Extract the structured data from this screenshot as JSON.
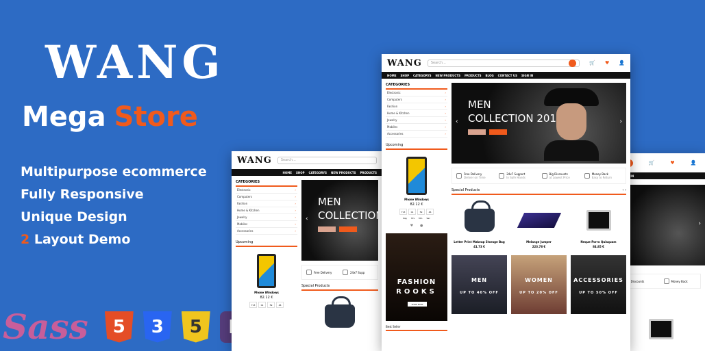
{
  "promo": {
    "logo": "WANG",
    "title_white": "Mega",
    "title_orange": "Store",
    "features": [
      "Multipurpose ecommerce",
      "Fully Responsive",
      "Unique Design"
    ],
    "layout_num": "2",
    "layout_text": "Layout Demo",
    "tech": {
      "sass": "Sass",
      "html5": "5",
      "css3": "3",
      "js": "5",
      "bootstrap": "B"
    }
  },
  "store": {
    "logo": "WANG",
    "search_placeholder": "Search...",
    "nav": [
      "HOME",
      "SHOP",
      "CATEGORYS",
      "NEW PRODUCTS",
      "PRODUCTS",
      "BLOG",
      "CONTACT US",
      "SIGN IN"
    ],
    "categories_title": "CATEGORIES",
    "categories": [
      "Electronic",
      "Computers",
      "Fashion",
      "Home &amp; Kitchen",
      "Jewelry",
      "Mobiles",
      "Accessories"
    ],
    "upcoming_title": "Upcoming",
    "upcoming_product": {
      "name": "Phone Windows",
      "price": "82.12 €",
      "countdown": [
        "713",
        "01",
        "59",
        "46"
      ],
      "countdown_labels": [
        "Day",
        "Hrs",
        "Min",
        "Sec"
      ]
    },
    "hero": {
      "line1": "MEN",
      "line2": "COLLECTION 2019",
      "line2_short": "COLLECTION"
    },
    "services": [
      {
        "title": "Free Delivery",
        "sub": "Deliver on Time"
      },
      {
        "title": "24x7 Support",
        "sub": "In Safe Hands"
      },
      {
        "title": "Big Discounts",
        "sub": "at Lowest Price"
      },
      {
        "title": "Money Back",
        "sub": "Easy to Return"
      }
    ],
    "services_short": [
      "Free Delivery",
      "24x7 Supp"
    ],
    "special_title": "Special Products",
    "products": [
      {
        "name": "Letter Print Makeup Storage Bag",
        "price": "41.73 €"
      },
      {
        "name": "Melange Jumper",
        "price": "223.78 €"
      },
      {
        "name": "Neque Porro Quisquam",
        "price": "84.85 €"
      }
    ],
    "banners": [
      {
        "label": "MEN",
        "sub": "UP TO 40% OFF"
      },
      {
        "label": "WOMEN",
        "sub": "UP TO 20% OFF"
      },
      {
        "label": "ACCESSORIES",
        "sub": "UP TO 50% OFF"
      }
    ],
    "fashion": {
      "l1": "FASHION",
      "l2": "ROOKS",
      "shop": "SHOP NOW"
    },
    "best_seller": "Best Seller",
    "right_nav": "SIGN IN",
    "right_hero_char": "9"
  }
}
